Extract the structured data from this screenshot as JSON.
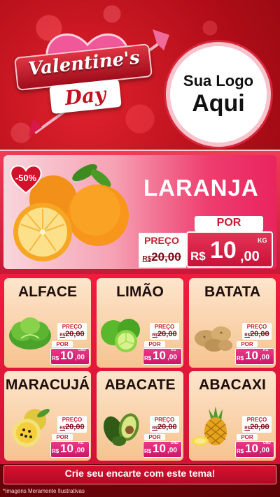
{
  "header": {
    "valentine_line1": "Valentine's",
    "valentine_line2": "Day",
    "logo_line1": "Sua Logo",
    "logo_line2": "Aqui"
  },
  "hero": {
    "discount": "-50%",
    "name": "LARANJA",
    "preco_label": "PREÇO",
    "old_currency": "R$",
    "old_price": "20,00",
    "por_label": "POR",
    "currency": "R$",
    "price_int": "10",
    "price_cents": ",00",
    "unit": "KG"
  },
  "products": [
    {
      "name": "ALFACE",
      "preco_label": "PREÇO",
      "old_currency": "R$",
      "old_price": "20,00",
      "por_label": "POR",
      "currency": "R$",
      "price_int": "10",
      "price_cents": ",00",
      "unit": "UND"
    },
    {
      "name": "LIMÃO",
      "preco_label": "PREÇO",
      "old_currency": "R$",
      "old_price": "20,00",
      "por_label": "POR",
      "currency": "R$",
      "price_int": "10",
      "price_cents": ",00",
      "unit": "KG"
    },
    {
      "name": "BATATA",
      "preco_label": "PREÇO",
      "old_currency": "R$",
      "old_price": "20,00",
      "por_label": "POR",
      "currency": "R$",
      "price_int": "10",
      "price_cents": ",00",
      "unit": "KG"
    },
    {
      "name": "MARACUJÁ",
      "preco_label": "PREÇO",
      "old_currency": "R$",
      "old_price": "20,00",
      "por_label": "POR",
      "currency": "R$",
      "price_int": "10",
      "price_cents": ",00",
      "unit": "KG"
    },
    {
      "name": "ABACATE",
      "preco_label": "PREÇO",
      "old_currency": "R$",
      "old_price": "20,00",
      "por_label": "POR",
      "currency": "R$",
      "price_int": "10",
      "price_cents": ",00",
      "unit": "UND"
    },
    {
      "name": "ABACAXI",
      "preco_label": "PREÇO",
      "old_currency": "R$",
      "old_price": "20,00",
      "por_label": "POR",
      "currency": "R$",
      "price_int": "10",
      "price_cents": ",00",
      "unit": "UND"
    }
  ],
  "footer": {
    "cta": "Crie seu encarte com este tema!",
    "disclaimer": "*Imagens Meramente Ilustrativas"
  },
  "colors": {
    "background_red": "#b10d18",
    "accent_pink": "#e9245e",
    "price_red": "#c51b2e",
    "card_peach": "#f6c38f"
  },
  "icons": [
    "heart-icon",
    "arrow-icon",
    "orange-image",
    "lettuce-image",
    "lime-image",
    "potato-image",
    "passion-fruit-image",
    "avocado-image",
    "pineapple-image"
  ]
}
